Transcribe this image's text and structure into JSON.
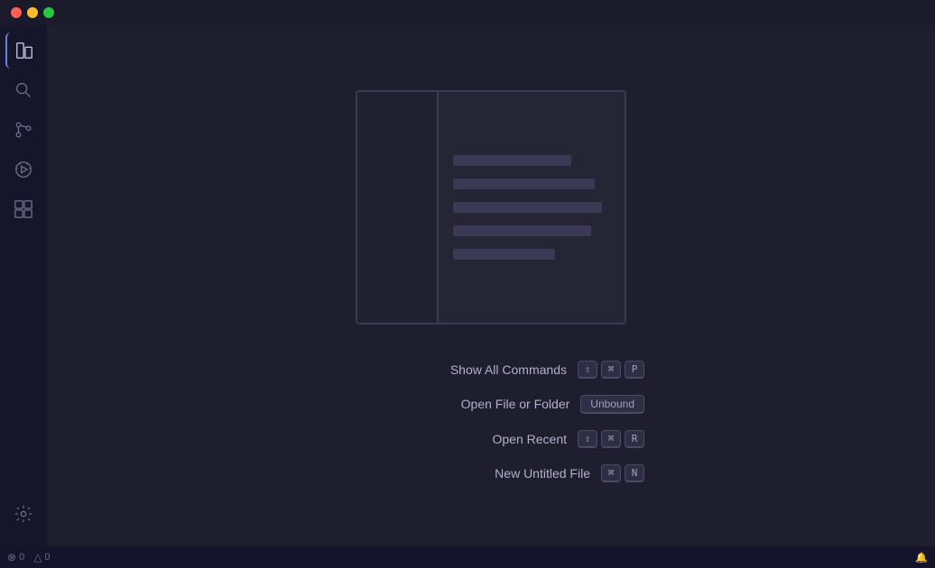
{
  "titlebar": {
    "traffic": {
      "close": "close",
      "minimize": "minimize",
      "maximize": "maximize"
    }
  },
  "activity_bar": {
    "icons": [
      {
        "name": "explorer-icon",
        "label": "Explorer",
        "active": true
      },
      {
        "name": "search-icon",
        "label": "Search",
        "active": false
      },
      {
        "name": "source-control-icon",
        "label": "Source Control",
        "active": false
      },
      {
        "name": "run-debug-icon",
        "label": "Run and Debug",
        "active": false
      },
      {
        "name": "extensions-icon",
        "label": "Extensions",
        "active": false
      }
    ],
    "bottom_icons": [
      {
        "name": "settings-icon",
        "label": "Settings",
        "active": false
      }
    ]
  },
  "shortcuts": [
    {
      "label": "Show All Commands",
      "keys": [
        "⇧",
        "⌘",
        "P"
      ]
    },
    {
      "label": "Open File or Folder",
      "keys": [
        "Unbound"
      ]
    },
    {
      "label": "Open Recent",
      "keys": [
        "⇧",
        "⌘",
        "R"
      ]
    },
    {
      "label": "New Untitled File",
      "keys": [
        "⌘",
        "N"
      ]
    }
  ],
  "statusbar": {
    "errors": "0",
    "warnings": "0",
    "bell_icon": "🔔"
  }
}
